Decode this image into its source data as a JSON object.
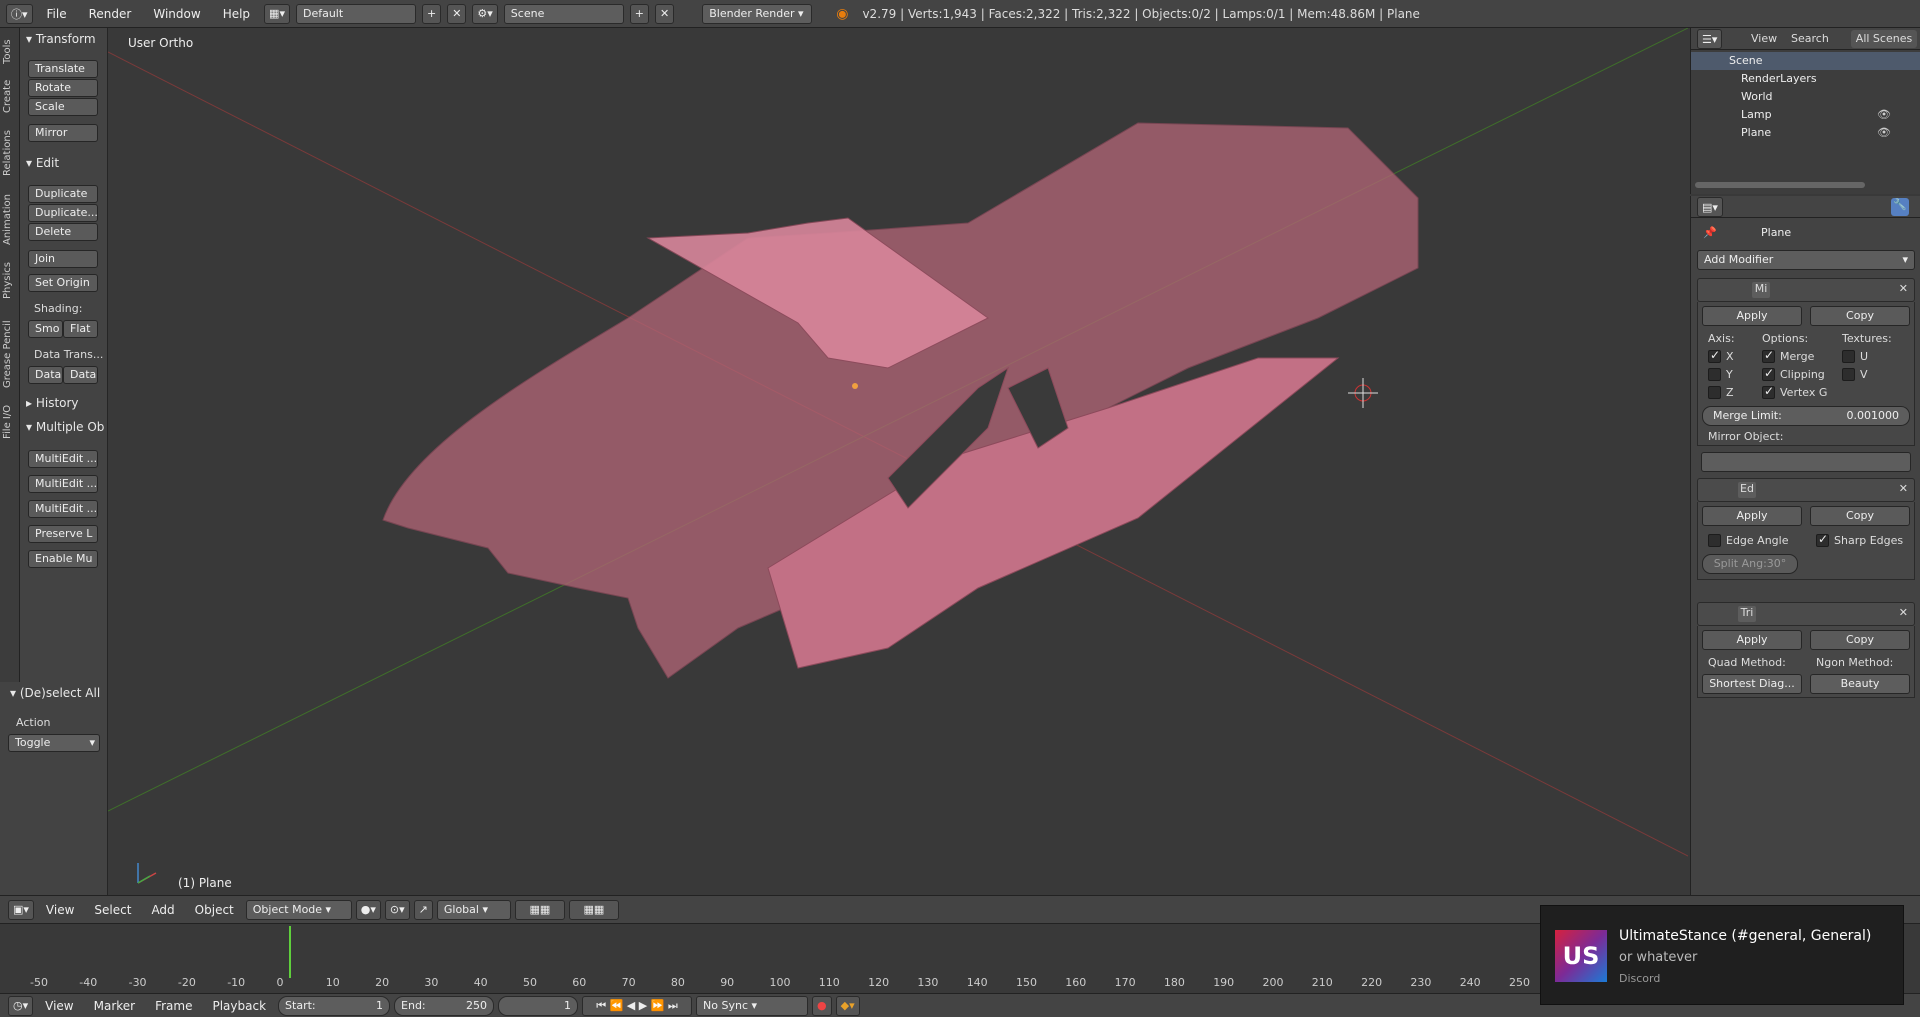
{
  "topbar": {
    "menus": [
      "File",
      "Render",
      "Window",
      "Help"
    ],
    "layout": "Default",
    "scene": "Scene",
    "engine": "Blender Render",
    "stats": "v2.79 | Verts:1,943 | Faces:2,322 | Tris:2,322 | Objects:0/2 | Lamps:0/1 | Mem:48.86M | Plane"
  },
  "vtabs": [
    "Tools",
    "Create",
    "Relations",
    "Animation",
    "Physics",
    "Grease Pencil",
    "File I/O"
  ],
  "toolshelf": {
    "transform_title": "Transform",
    "transform_buttons": [
      "Translate",
      "Rotate",
      "Scale",
      "Mirror"
    ],
    "edit_title": "Edit",
    "edit_buttons": [
      "Duplicate",
      "Duplicate...",
      "Delete",
      "Join",
      "Set Origin"
    ],
    "shading_label": "Shading:",
    "shading_buttons": [
      "Smo",
      "Flat"
    ],
    "data_transfer_label": "Data Trans...",
    "data_buttons": [
      "Data",
      "Data"
    ],
    "history_title": "History",
    "multiple_title": "Multiple Ob",
    "multi_buttons": [
      "MultiEdit ...",
      "MultiEdit ...",
      "MultiEdit ...",
      "Preserve L",
      "Enable Mu"
    ]
  },
  "redo": {
    "title": "(De)select All",
    "action_label": "Action",
    "action_value": "Toggle"
  },
  "viewport": {
    "view_label": "User Ortho",
    "object_label": "(1) Plane"
  },
  "outliner": {
    "menus": [
      "View",
      "Search",
      "All Scenes"
    ],
    "items": [
      "Scene",
      "RenderLayers",
      "World",
      "Lamp",
      "Plane"
    ]
  },
  "properties": {
    "object_name": "Plane",
    "add_modifier": "Add Modifier",
    "mirror": {
      "name": "Mi",
      "apply": "Apply",
      "copy": "Copy",
      "axis_label": "Axis:",
      "options_label": "Options:",
      "textures_label": "Textures:",
      "axes": [
        "X",
        "Y",
        "Z"
      ],
      "options": [
        "Merge",
        "Clipping",
        "Vertex G"
      ],
      "textures": [
        "U",
        "V"
      ],
      "merge_limit_label": "Merge Limit:",
      "merge_limit_value": "0.001000",
      "mirror_object_label": "Mirror Object:"
    },
    "edgesplit": {
      "name": "Ed",
      "apply": "Apply",
      "copy": "Copy",
      "edge_angle": "Edge Angle",
      "sharp_edges": "Sharp Edges",
      "split_angle": "Split Ang:30°"
    },
    "triangulate": {
      "name": "Tri",
      "apply": "Apply",
      "copy": "Copy",
      "quad_label": "Quad Method:",
      "ngon_label": "Ngon Method:",
      "quad_value": "Shortest Diag...",
      "ngon_value": "Beauty"
    }
  },
  "vp_header": {
    "menus": [
      "View",
      "Select",
      "Add",
      "Object"
    ],
    "mode": "Object Mode",
    "orientation": "Global"
  },
  "timeline": {
    "ticks": [
      "-50",
      "-40",
      "-30",
      "-20",
      "-10",
      "0",
      "10",
      "20",
      "30",
      "40",
      "50",
      "60",
      "70",
      "80",
      "90",
      "100",
      "110",
      "120",
      "130",
      "140",
      "150",
      "160",
      "170",
      "180",
      "190",
      "200",
      "210",
      "220",
      "230",
      "240",
      "250"
    ]
  },
  "tl_header": {
    "menus": [
      "View",
      "Marker",
      "Frame",
      "Playback"
    ],
    "start": "Start:",
    "start_val": "1",
    "end": "End:",
    "end_val": "250",
    "frame": "1",
    "sync": "No Sync"
  },
  "toast": {
    "logo": "US",
    "title": "UltimateStance (#general, General)",
    "body": "or whatever",
    "app": "Discord"
  }
}
